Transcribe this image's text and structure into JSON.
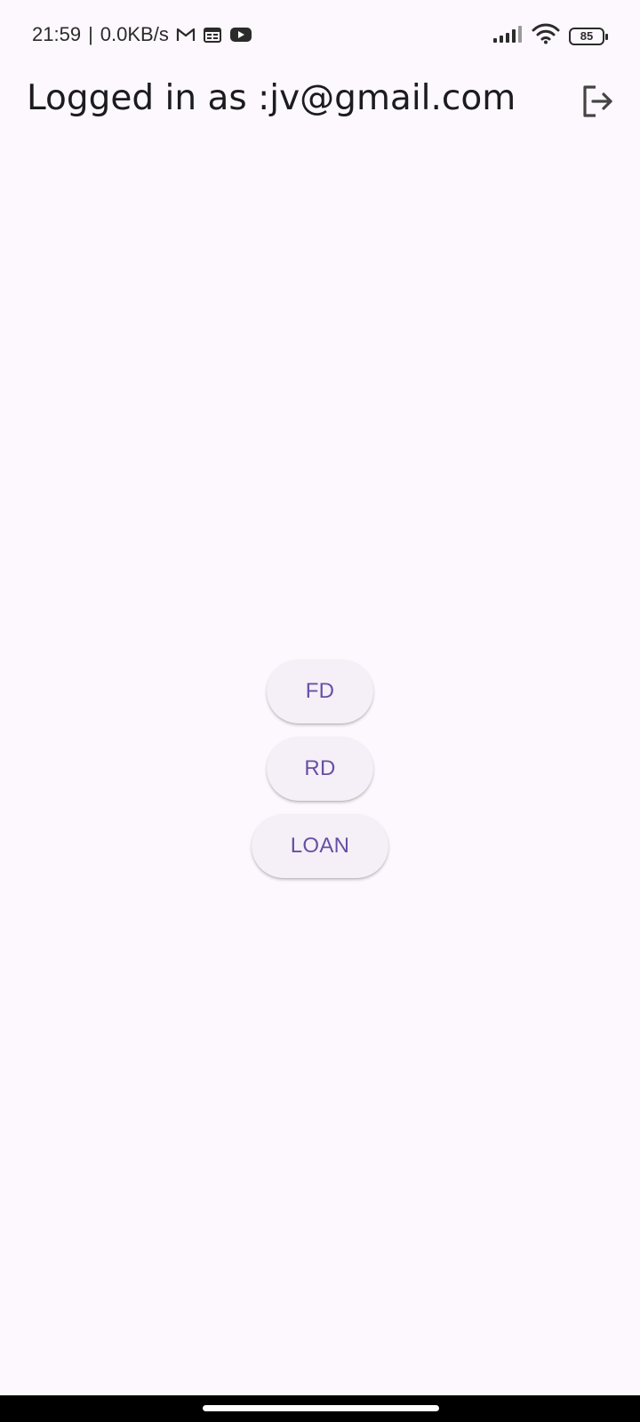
{
  "status_bar": {
    "time": "21:59",
    "separator": "|",
    "network_speed": "0.0KB/s",
    "notification_icons": [
      "gmail-icon",
      "calendar-icon",
      "youtube-icon"
    ],
    "battery_level": "85",
    "signal_icon": "cellular-signal-icon",
    "wifi_icon": "wifi-icon"
  },
  "app_bar": {
    "title": "Logged in as :jv@gmail.com",
    "logout_icon": "logout-icon"
  },
  "actions": {
    "fd_label": "FD",
    "rd_label": "RD",
    "loan_label": "LOAN"
  },
  "colors": {
    "background": "#fdf8fd",
    "button_background": "#f5f0f7",
    "button_text": "#6750a4",
    "title_text": "#1c1b1f",
    "nav_bar": "#000000"
  }
}
